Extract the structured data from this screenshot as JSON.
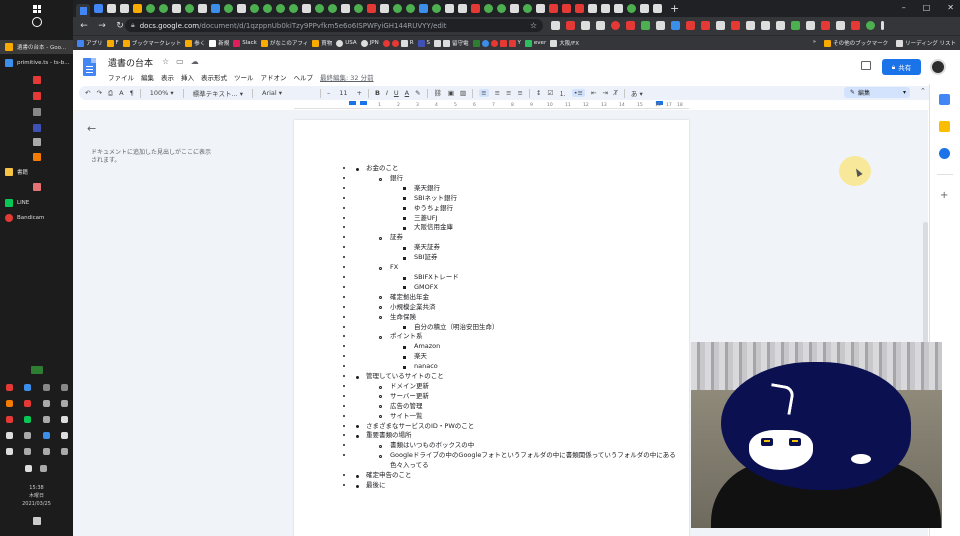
{
  "taskbar": {
    "apps": [
      {
        "label": "遺書の台本 - Goo...",
        "color": "#f9ab00"
      },
      {
        "label": "primitive.ts - ts-b...",
        "color": "#3b8eea"
      },
      {
        "label": "書籍",
        "color": "#f6c445"
      },
      {
        "label": "LINE",
        "color": "#06c755"
      },
      {
        "label": "Bandicam",
        "color": "#e53935"
      }
    ],
    "clock_time": "15:38",
    "clock_day": "木曜日",
    "clock_date": "2021/03/25"
  },
  "browser": {
    "url_host": "docs.google.com",
    "url_path": "/document/d/1qzppnUb0kiTzy9PPvfkm5e6o6ISPWFyiGH144RUVYY/edit",
    "bookmarks": [
      {
        "label": "アプリ",
        "color": "#4285f4"
      },
      {
        "label": "F",
        "color": "#f9ab00"
      },
      {
        "label": "ブックマークレット",
        "color": "#f9ab00"
      },
      {
        "label": "参く",
        "color": "#f9ab00"
      },
      {
        "label": "新規",
        "color": "#fff"
      },
      {
        "label": "Slack",
        "color": "#e01e5a"
      },
      {
        "label": "がなこのアフィ",
        "color": "#f9ab00"
      },
      {
        "label": "買物",
        "color": "#f9ab00"
      },
      {
        "label": "USA",
        "color": "#ddd"
      },
      {
        "label": "JPN",
        "color": "#ddd"
      },
      {
        "label": "R",
        "color": "#bf0000"
      },
      {
        "label": "S",
        "color": "#3f51b5"
      },
      {
        "label": "留守電",
        "color": "#2e7d32"
      },
      {
        "label": "Y",
        "color": "#e53935"
      },
      {
        "label": "ever",
        "color": "#2dbe60"
      },
      {
        "label": "大阪/FX",
        "color": "#ddd"
      }
    ],
    "bookmarks_more": "»",
    "bookmarks_other": "その他のブックマーク",
    "reading_list": "リーディング リスト"
  },
  "docs": {
    "title": "遺書の台本",
    "menu": [
      "ファイル",
      "編集",
      "表示",
      "挿入",
      "表示形式",
      "ツール",
      "アドオン",
      "ヘルプ"
    ],
    "last_edit": "最終編集: 32 分前",
    "share_label": "共有",
    "toolbar": {
      "zoom": "100%",
      "style": "標準テキスト...",
      "font": "Arial",
      "size": "11",
      "mode_label": "編集"
    },
    "ruler_ticks": [
      "1",
      "2",
      "3",
      "4",
      "5",
      "6",
      "7",
      "8",
      "9",
      "10",
      "11",
      "12",
      "13",
      "14",
      "15",
      "16",
      "17",
      "18"
    ],
    "outline_hint": "ドキュメントに追加した見出しがここに表示されます。"
  },
  "document": {
    "items": [
      {
        "level": 1,
        "text": "お金のこと"
      },
      {
        "level": 2,
        "text": "銀行"
      },
      {
        "level": 3,
        "text": "楽天銀行"
      },
      {
        "level": 3,
        "text": "SBIネット銀行"
      },
      {
        "level": 3,
        "text": "ゆうちょ銀行"
      },
      {
        "level": 3,
        "text": "三菱UFJ"
      },
      {
        "level": 3,
        "text": "大阪信用金庫"
      },
      {
        "level": 2,
        "text": "証券"
      },
      {
        "level": 3,
        "text": "楽天証券"
      },
      {
        "level": 3,
        "text": "SBI証券"
      },
      {
        "level": 2,
        "text": "FX"
      },
      {
        "level": 3,
        "text": "SBIFXトレード"
      },
      {
        "level": 3,
        "text": "GMOFX"
      },
      {
        "level": 2,
        "text": "確定拠出年金"
      },
      {
        "level": 2,
        "text": "小規模企業共済"
      },
      {
        "level": 2,
        "text": "生命保険"
      },
      {
        "level": 3,
        "text": "自分の積立（明治安田生命）"
      },
      {
        "level": 2,
        "text": "ポイント系"
      },
      {
        "level": 3,
        "text": "Amazon"
      },
      {
        "level": 3,
        "text": "楽天"
      },
      {
        "level": 3,
        "text": "nanaco"
      },
      {
        "level": 1,
        "text": "管理しているサイトのこと"
      },
      {
        "level": 2,
        "text": "ドメイン更新"
      },
      {
        "level": 2,
        "text": "サーバー更新"
      },
      {
        "level": 2,
        "text": "広告の管理"
      },
      {
        "level": 2,
        "text": "サイト一覧"
      },
      {
        "level": 1,
        "text": "さまざまなサービスのID・PWのこと"
      },
      {
        "level": 1,
        "text": "重要書類の場所"
      },
      {
        "level": 2,
        "text": "書類はいつものボックスの中"
      },
      {
        "level": 2,
        "text": "Googleドライブの中のGoogleフォトというフォルダの中に書類関係っていうフォルダの中にある色々入ってる"
      },
      {
        "level": 1,
        "text": "確定申告のこと"
      },
      {
        "level": 1,
        "text": "最後に"
      }
    ]
  },
  "colors": {
    "accent": "#1a73e8",
    "docs_blue": "#4285f4",
    "canvas_bg": "#f0f4f9"
  }
}
